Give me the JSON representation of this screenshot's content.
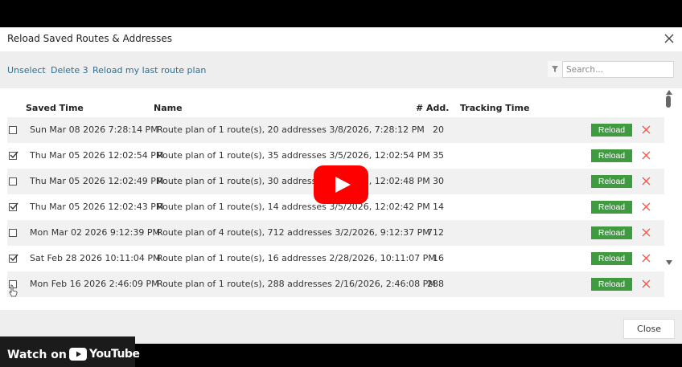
{
  "dialog": {
    "title": "Reload Saved Routes & Addresses",
    "close_icon": "close-icon"
  },
  "toolbar": {
    "links": [
      "Unselect",
      "Delete 3",
      "Reload my last route plan"
    ],
    "search_placeholder": "Search...",
    "filter_icon": "filter-icon"
  },
  "table": {
    "headers": [
      "Saved Time",
      "Name",
      "# Add.",
      "Tracking Time"
    ],
    "rows": [
      {
        "checked": false,
        "time": "Sun Mar 08 2026 7:28:14 PM",
        "name": "Route plan of 1 route(s), 20 addresses 3/8/2026, 7:28:12 PM",
        "add": "20",
        "tracking": "",
        "reload": "Reload"
      },
      {
        "checked": true,
        "time": "Thu Mar 05 2026 12:02:54 PM",
        "name": "Route plan of 1 route(s), 35 addresses 3/5/2026, 12:02:54 PM",
        "add": "35",
        "tracking": "",
        "reload": "Reload"
      },
      {
        "checked": false,
        "time": "Thu Mar 05 2026 12:02:49 PM",
        "name": "Route plan of 1 route(s), 30 addresses 3/5/2026, 12:02:48 PM",
        "add": "30",
        "tracking": "",
        "reload": "Reload"
      },
      {
        "checked": true,
        "time": "Thu Mar 05 2026 12:02:43 PM",
        "name": "Route plan of 1 route(s), 14 addresses 3/5/2026, 12:02:42 PM",
        "add": "14",
        "tracking": "",
        "reload": "Reload"
      },
      {
        "checked": false,
        "time": "Mon Mar 02 2026 9:12:39 PM",
        "name": "Route plan of 4 route(s), 712 addresses 3/2/2026, 9:12:37 PM",
        "add": "712",
        "tracking": "",
        "reload": "Reload"
      },
      {
        "checked": true,
        "time": "Sat Feb 28 2026 10:11:04 PM",
        "name": "Route plan of 1 route(s), 16 addresses 2/28/2026, 10:11:07 PM",
        "add": "16",
        "tracking": "",
        "reload": "Reload"
      },
      {
        "checked": false,
        "time": "Mon Feb 16 2026 2:46:09 PM",
        "name": "Route plan of 1 route(s), 288 addresses 2/16/2026, 2:46:08 PM",
        "add": "288",
        "tracking": "",
        "reload": "Reload"
      }
    ]
  },
  "footer": {
    "close_label": "Close"
  },
  "youtube": {
    "watch_label": "Watch on",
    "brand": "YouTube",
    "play_icon": "youtube-play-icon",
    "color": "#ff0000"
  },
  "colors": {
    "reload_green": "#3e9b3e",
    "link_blue": "#2f6f8f",
    "delete_red": "#e05a4f"
  }
}
